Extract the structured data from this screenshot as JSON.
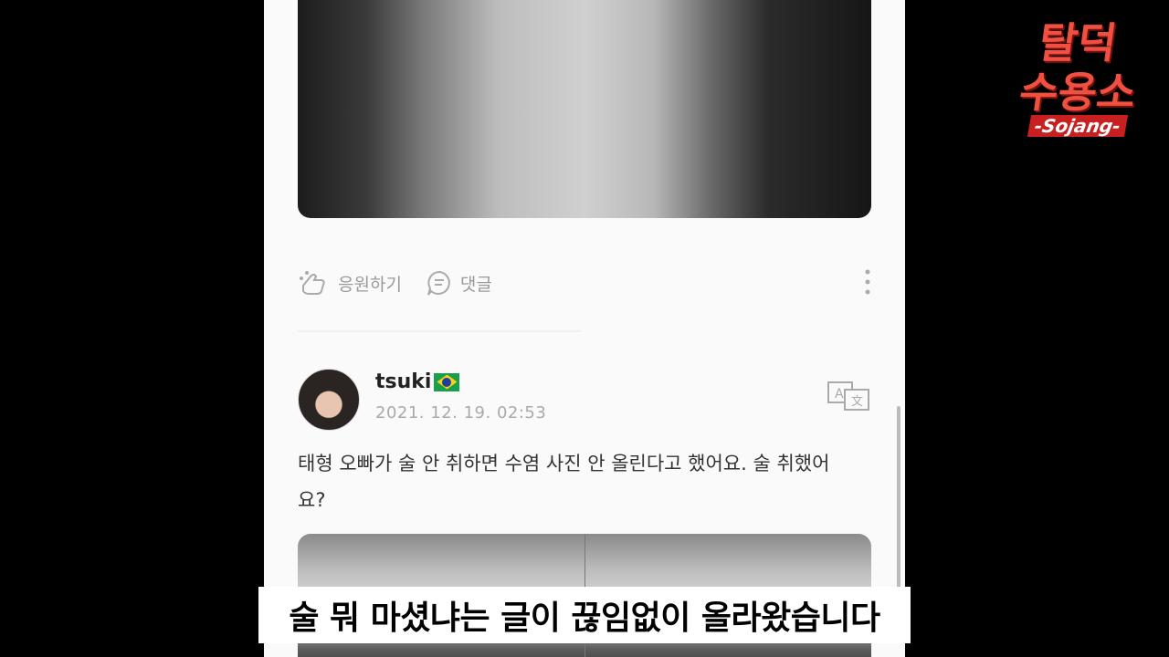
{
  "post_actions": {
    "cheer_label": "응원하기",
    "comment_label": "댓글"
  },
  "comment": {
    "username": "tsuki",
    "timestamp": "2021. 12. 19. 02:53",
    "text": "태형 오빠가 술 안 취하면 수염 사진 안 올린다고 했어요. 술 취했어요?"
  },
  "subtitle": "술 뭐 마셨냐는 글이 끊임없이 올라왔습니다",
  "logo": {
    "line1": "탈덕",
    "line2": "수용소",
    "sub": "-Sojang-"
  },
  "colors": {
    "logo_red": "#f05040",
    "subtitle_bg": "#ffffff",
    "flag": "brazil"
  }
}
